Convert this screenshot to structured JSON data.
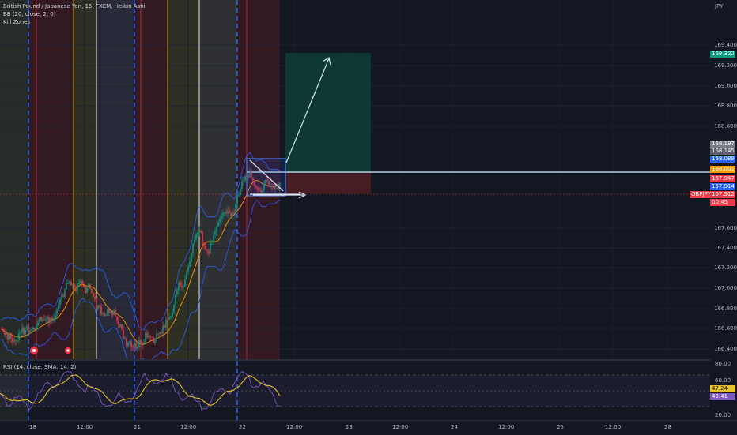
{
  "header": {
    "symbol_title": "British Pound / Japanese Yen, 15, FXCM, Heikin Ashi",
    "indicator_bb": "BB (20, close, 2, 0)",
    "indicator_kz": "Kill Zones"
  },
  "price_axis": {
    "currency": "JPY",
    "ticks": [
      "169.400",
      "169.200",
      "169.000",
      "168.800",
      "168.600",
      "167.600",
      "167.400",
      "167.200",
      "167.000",
      "166.800",
      "166.600",
      "166.400"
    ],
    "tags": [
      {
        "text": "169.322",
        "color": "#089981"
      },
      {
        "text": "168.197",
        "color": "#787b86"
      },
      {
        "text": "168.145",
        "color": "#5d606b"
      },
      {
        "text": "168.089",
        "color": "#2962ff"
      },
      {
        "text": "168.001",
        "color": "#ff9800"
      },
      {
        "text": "167.947",
        "color": "#f23645"
      },
      {
        "text": "167.914",
        "color": "#2962ff"
      },
      {
        "text": "167.912",
        "color": "#f23645"
      },
      {
        "text": "00:45",
        "color": "#f23645"
      }
    ],
    "symbol_tag": "GBPJPY"
  },
  "rsi": {
    "label": "RSI (14, close, SMA, 14, 2)",
    "ticks": [
      "80.00",
      "60.00",
      "20.00"
    ],
    "tags": [
      {
        "text": "47.24",
        "color": "#e6c229"
      },
      {
        "text": "43.41",
        "color": "#7e57c2"
      }
    ]
  },
  "time_axis": {
    "labels": [
      "18",
      "12:00",
      "21",
      "12:00",
      "22",
      "12:00",
      "23",
      "12:00",
      "24",
      "12:00",
      "25",
      "12:00",
      "28"
    ]
  },
  "colors": {
    "background": "#131722",
    "bull": "#089981",
    "bear": "#f23645",
    "bb_band": "#2962ff",
    "bb_basis": "#ff9800",
    "rsi_line": "#7e57c2",
    "rsi_ma": "#e6c229",
    "position_target": "#0d3a36",
    "position_stop": "#4a1d25"
  }
}
